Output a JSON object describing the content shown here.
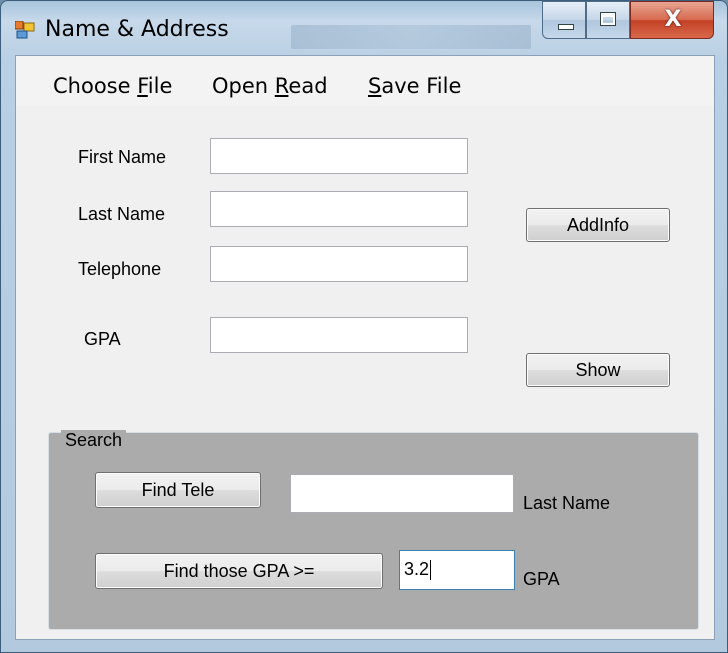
{
  "window": {
    "title": "Name & Address"
  },
  "caption": {
    "close_glyph": "X"
  },
  "menu": {
    "choose_file": {
      "pre": "Choose ",
      "accel": "F",
      "post": "ile"
    },
    "open_read": {
      "pre": "Open ",
      "accel": "R",
      "post": "ead"
    },
    "save_file": {
      "pre": "",
      "accel": "S",
      "post": "ave File"
    }
  },
  "form": {
    "first_name_label": "First Name",
    "last_name_label": "Last Name",
    "telephone_label": "Telephone",
    "gpa_label": "GPA",
    "first_name_value": "",
    "last_name_value": "",
    "telephone_value": "",
    "gpa_value": "",
    "addinfo_button": "AddInfo",
    "show_button": "Show"
  },
  "search": {
    "group_label": "Search",
    "find_tele_button": "Find Tele",
    "last_name_input_value": "",
    "last_name_caption": "Last Name",
    "find_gpa_button": "Find those GPA >=",
    "gpa_input_value": "3.2",
    "gpa_caption": "GPA"
  }
}
